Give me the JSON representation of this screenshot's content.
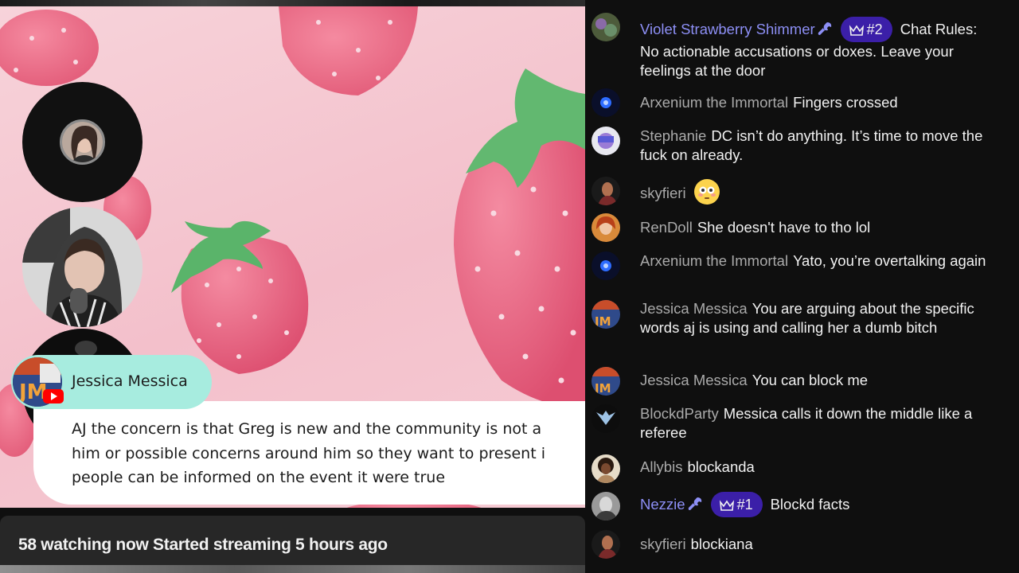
{
  "stream": {
    "overlay_author": "Jessica Messica",
    "overlay_message": "AJ the concern is that Greg is new and the community is not a\nhim or possible concerns around him so they want to present i\npeople can be informed on the event it were true",
    "info_line": "58 watching now  Started streaming 5 hours ago"
  },
  "chat": {
    "messages": [
      {
        "author": "Violet Strawberry Shimmer",
        "moderator": true,
        "rank": "#2",
        "text": "Chat Rules: No actionable accusations or doxes. Leave your feelings at the door"
      },
      {
        "author": "Arxenium the Immortal",
        "text": "Fingers crossed"
      },
      {
        "author": "Stephanie",
        "text": "DC isn’t do anything. It’s time to move the fuck on already."
      },
      {
        "author": "skyfieri",
        "text": "",
        "emoji": "flushed-face"
      },
      {
        "author": "RenDoll",
        "text": "She doesn't have to tho lol"
      },
      {
        "author": "Arxenium the Immortal",
        "text": "Yato, you’re overtalking again"
      },
      {
        "author": "Jessica Messica",
        "text": "You are arguing about the specific words aj is using and calling her a dumb bitch"
      },
      {
        "author": "Jessica Messica",
        "text": "You can block me"
      },
      {
        "author": "BlockdParty",
        "text": "Messica calls it down the middle like a referee"
      },
      {
        "author": "Allybis",
        "text": "blockanda"
      },
      {
        "author": "Nezzie",
        "moderator": true,
        "rank": "#1",
        "text": "Blockd facts"
      },
      {
        "author": "skyfieri",
        "text": "blockiana"
      }
    ]
  },
  "colors": {
    "chat_bg": "#0f0f0f",
    "moderator_name": "#8d8ff5",
    "rank_badge": "#3b1fa8",
    "overlay_name_bg": "#a7ecdf",
    "video_pink": "#f3c0cb"
  }
}
